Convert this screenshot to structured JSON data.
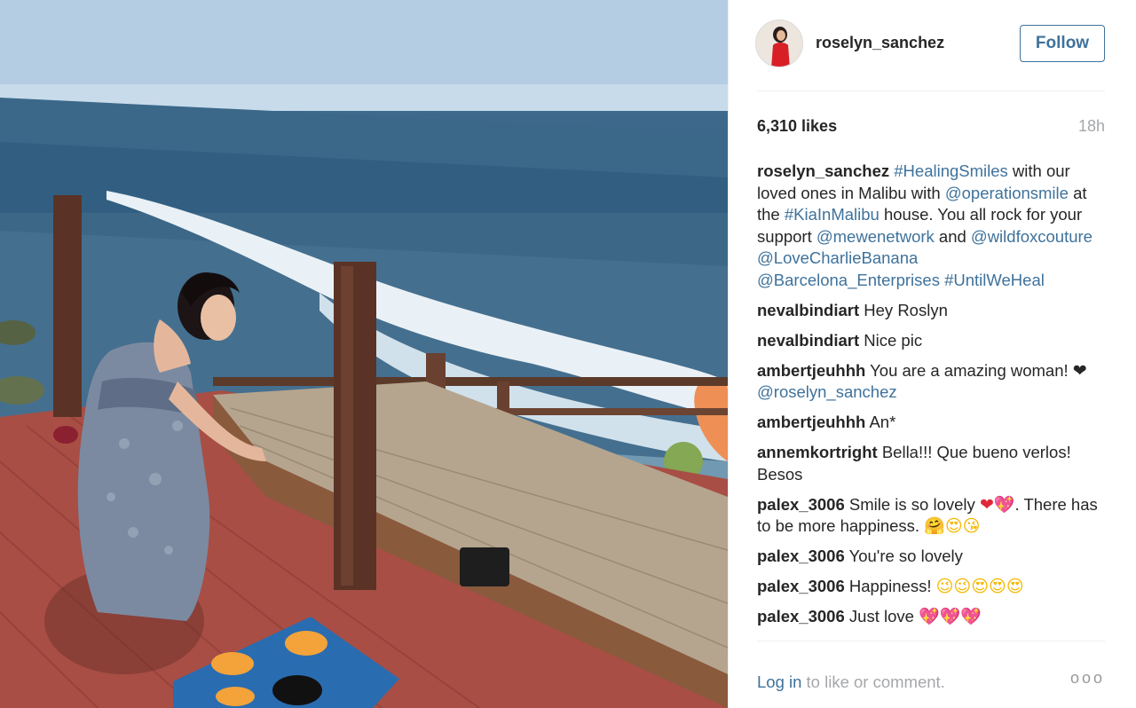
{
  "post": {
    "username": "roselyn_sanchez",
    "follow_label": "Follow",
    "likes": "6,310 likes",
    "time": "18h"
  },
  "caption": {
    "user": "roselyn_sanchez",
    "t1": " ",
    "tag1": "#HealingSmiles",
    "t2": " with our loved ones in Malibu with ",
    "m1": "@operationsmile",
    "t3": " at the ",
    "tag2": "#KiaInMalibu",
    "t4": " house. You all rock for your support ",
    "m2": "@mewenetwork",
    "t5": " and ",
    "m3": "@wildfoxcouture",
    "m4": "@LoveCharlieBanana",
    "m5": "@Barcelona_Enterprises",
    "tag3": "#UntilWeHeal"
  },
  "comments": [
    {
      "user": "nevalbindiart",
      "text": "Hey Roslyn"
    },
    {
      "user": "nevalbindiart",
      "text": "Nice pic"
    },
    {
      "user": "ambertjeuhhh",
      "text": "You are a amazing woman!",
      "heart": "❤",
      "mention": "@roselyn_sanchez"
    },
    {
      "user": "ambertjeuhhh",
      "text": "An*"
    },
    {
      "user": "annemkortright",
      "text": "Bella!!! Que bueno verlos! Besos"
    },
    {
      "user": "palex_3006",
      "text": "Smile is so lovely",
      "emoji_a": "❤💖",
      "text2": ". There has to be more happiness.",
      "emoji_b": "🤗😍😘"
    },
    {
      "user": "palex_3006",
      "text": "You're so lovely"
    },
    {
      "user": "palex_3006",
      "text": "Happiness!",
      "emoji": "😉😉😍😍😍"
    },
    {
      "user": "palex_3006",
      "text": "Just love",
      "emoji": "💖💖💖"
    }
  ],
  "footer": {
    "login_link": "Log in",
    "login_rest": " to like or comment.",
    "more": "ooo"
  },
  "icons": {
    "more": "ellipsis-icon",
    "avatar": "profile-photo"
  },
  "colors": {
    "link": "#3f729b",
    "text": "#262626",
    "muted": "#a5a7aa",
    "deck": "#b0534a"
  }
}
